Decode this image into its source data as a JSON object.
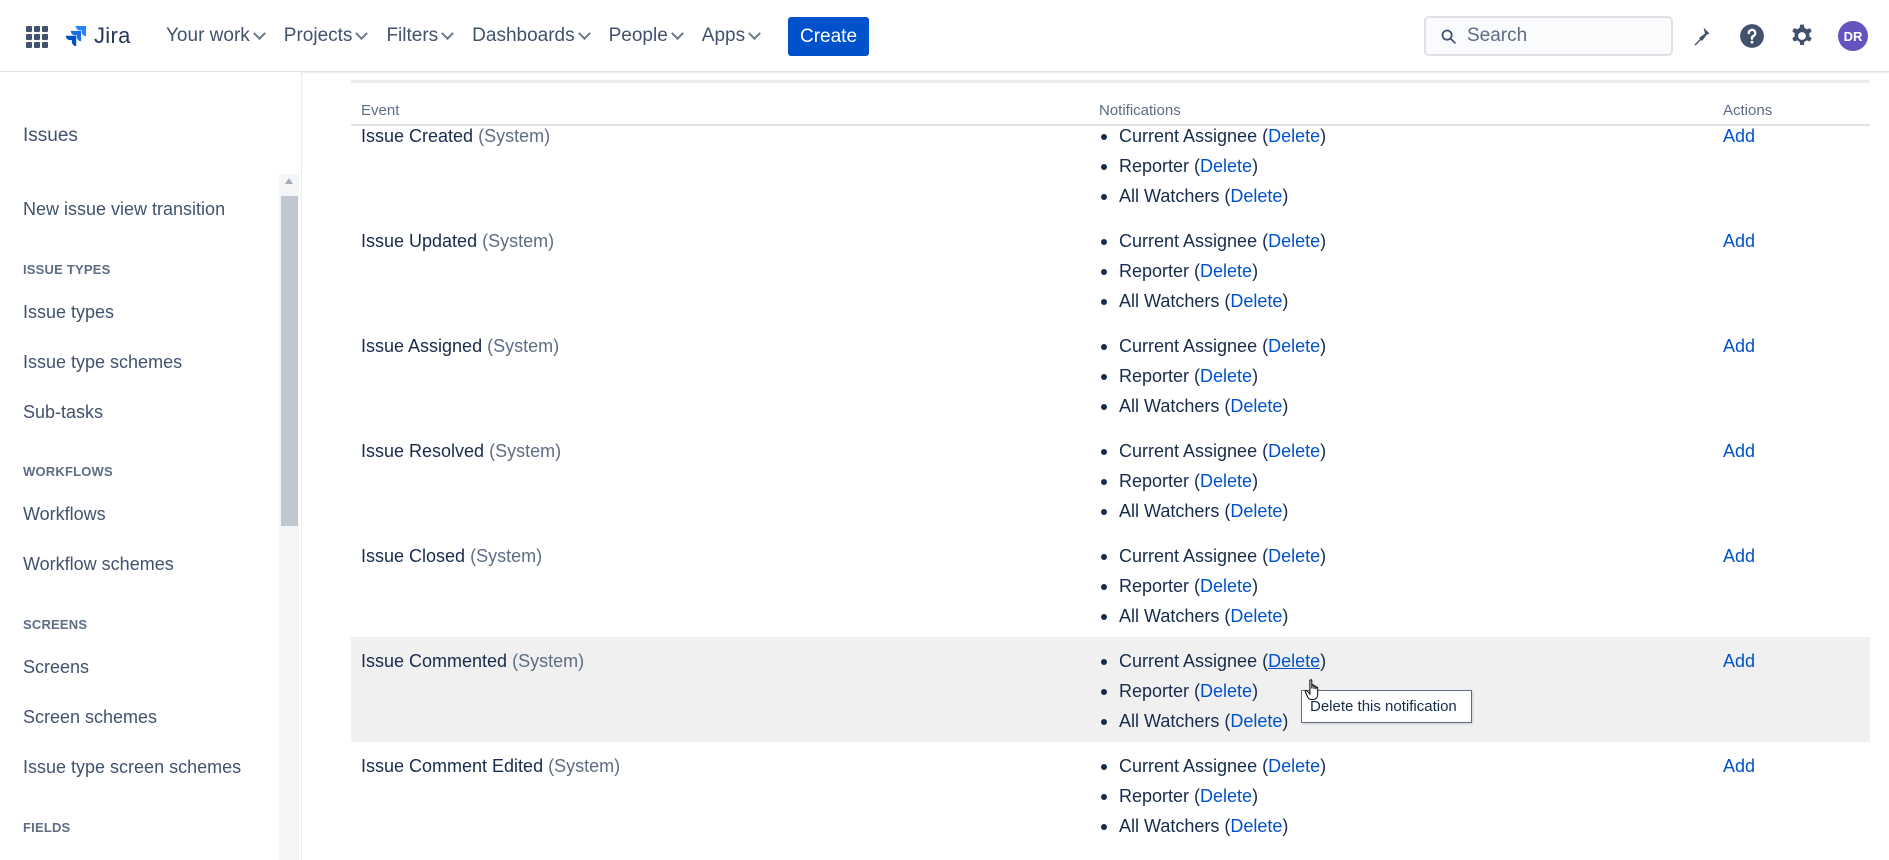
{
  "nav": {
    "logo": "Jira",
    "items": [
      {
        "label": "Your work"
      },
      {
        "label": "Projects"
      },
      {
        "label": "Filters"
      },
      {
        "label": "Dashboards"
      },
      {
        "label": "People"
      },
      {
        "label": "Apps"
      }
    ],
    "create": "Create",
    "search_placeholder": "Search",
    "avatar_initials": "DR",
    "icons": [
      "app-switcher-icon",
      "notifications-icon",
      "help-icon",
      "settings-icon"
    ]
  },
  "sidebar": {
    "title": "Issues",
    "items": [
      {
        "type": "link",
        "label": "New issue view transition"
      },
      {
        "type": "heading",
        "label": "ISSUE TYPES"
      },
      {
        "type": "link",
        "label": "Issue types"
      },
      {
        "type": "link",
        "label": "Issue type schemes"
      },
      {
        "type": "link",
        "label": "Sub-tasks"
      },
      {
        "type": "heading",
        "label": "WORKFLOWS"
      },
      {
        "type": "link",
        "label": "Workflows"
      },
      {
        "type": "link",
        "label": "Workflow schemes"
      },
      {
        "type": "heading",
        "label": "SCREENS"
      },
      {
        "type": "link",
        "label": "Screens"
      },
      {
        "type": "link",
        "label": "Screen schemes"
      },
      {
        "type": "link",
        "label": "Issue type screen schemes"
      },
      {
        "type": "heading",
        "label": "FIELDS"
      }
    ]
  },
  "table": {
    "headers": {
      "event": "Event",
      "notifications": "Notifications",
      "actions": "Actions"
    },
    "delete_label": "Delete",
    "add_label": "Add",
    "rows": [
      {
        "event": "Issue Created",
        "tag": "(System)",
        "notifications": [
          "Current Assignee",
          "Reporter",
          "All Watchers"
        ]
      },
      {
        "event": "Issue Updated",
        "tag": "(System)",
        "notifications": [
          "Current Assignee",
          "Reporter",
          "All Watchers"
        ]
      },
      {
        "event": "Issue Assigned",
        "tag": "(System)",
        "notifications": [
          "Current Assignee",
          "Reporter",
          "All Watchers"
        ]
      },
      {
        "event": "Issue Resolved",
        "tag": "(System)",
        "notifications": [
          "Current Assignee",
          "Reporter",
          "All Watchers"
        ]
      },
      {
        "event": "Issue Closed",
        "tag": "(System)",
        "notifications": [
          "Current Assignee",
          "Reporter",
          "All Watchers"
        ]
      },
      {
        "event": "Issue Commented",
        "tag": "(System)",
        "notifications": [
          "Current Assignee",
          "Reporter",
          "All Watchers"
        ],
        "hovered": true
      },
      {
        "event": "Issue Comment Edited",
        "tag": "(System)",
        "notifications": [
          "Current Assignee",
          "Reporter",
          "All Watchers"
        ]
      }
    ]
  },
  "tooltip": "Delete this notification",
  "colors": {
    "primary": "#0052cc",
    "avatar": "#6554c0",
    "hover_row": "#f0f0f0"
  }
}
